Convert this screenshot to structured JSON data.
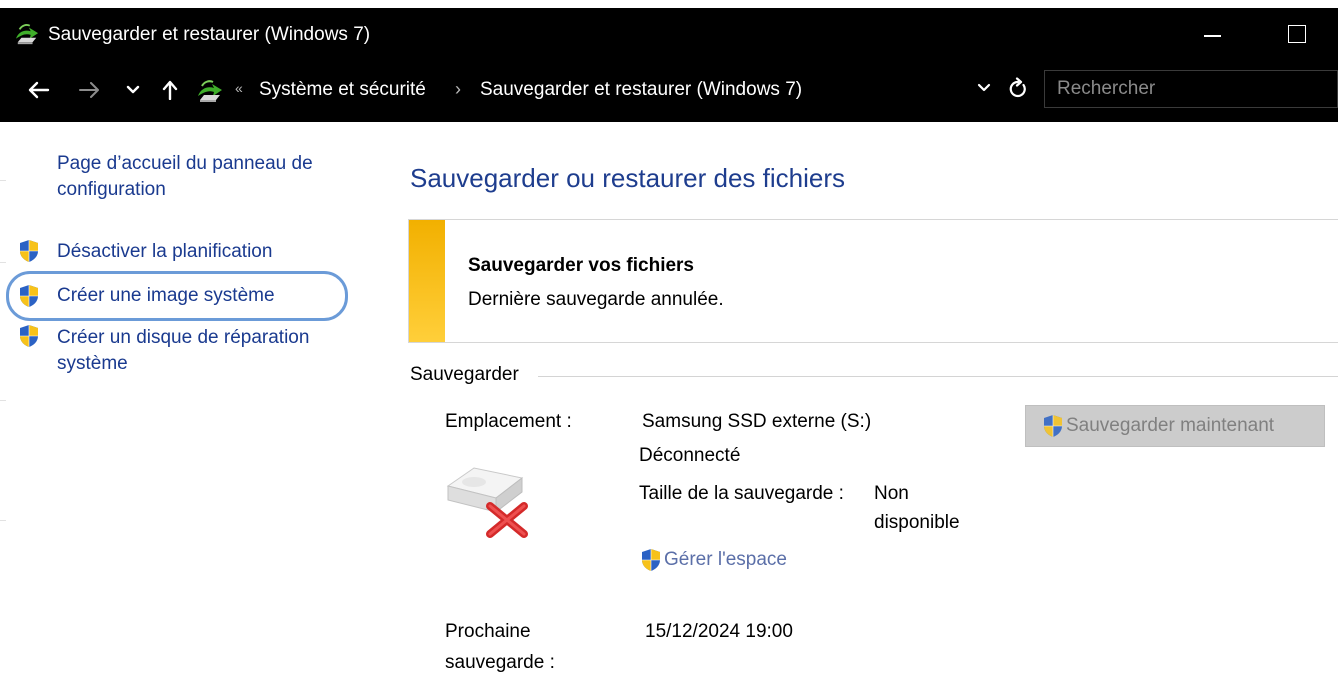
{
  "window": {
    "title": "Sauvegarder et restaurer (Windows 7)",
    "icon": "backup-restore-icon"
  },
  "address_bar": {
    "separator": "«",
    "crumbs": [
      "Système et sécurité",
      "Sauvegarder et restaurer (Windows 7)"
    ],
    "crumb_separator": "›",
    "search_placeholder": "Rechercher"
  },
  "left_pane": {
    "home_link": "Page d’accueil du panneau de configuration",
    "home_link_line1": "Page d’accueil du panneau de",
    "home_link_line2": "configuration",
    "tasks": [
      {
        "label": "Désactiver la planification",
        "icon": "uac-shield-icon"
      },
      {
        "label": "Créer une image système",
        "icon": "uac-shield-icon",
        "highlighted": true
      },
      {
        "label_line1": "Créer un disque de réparation",
        "label_line2": "système",
        "icon": "uac-shield-icon"
      }
    ]
  },
  "main": {
    "title": "Sauvegarder ou restaurer des fichiers",
    "status": {
      "title": "Sauvegarder vos fichiers",
      "message": "Dernière sauvegarde annulée.",
      "accent_color": "#f5b800"
    },
    "backup_section": {
      "label": "Sauvegarder",
      "location_label": "Emplacement :",
      "location_value": "Samsung SSD externe (S:)",
      "connection_status": "Déconnecté",
      "size_label": "Taille de la sauvegarde :",
      "size_value_line1": "Non",
      "size_value_line2": "disponible",
      "manage_space_link": "Gérer l'espace",
      "next_backup_label_line1": "Prochaine",
      "next_backup_label_line2": "sauvegarde :",
      "next_backup_value": "15/12/2024 19:00",
      "backup_now_button": "Sauvegarder maintenant"
    }
  },
  "colors": {
    "title_bar_bg": "#000000",
    "link_blue": "#1a3a8f",
    "heading_blue": "#1e3d8e",
    "highlight_ring": "#6b9bd8",
    "disabled_button_bg": "#cccccc"
  }
}
